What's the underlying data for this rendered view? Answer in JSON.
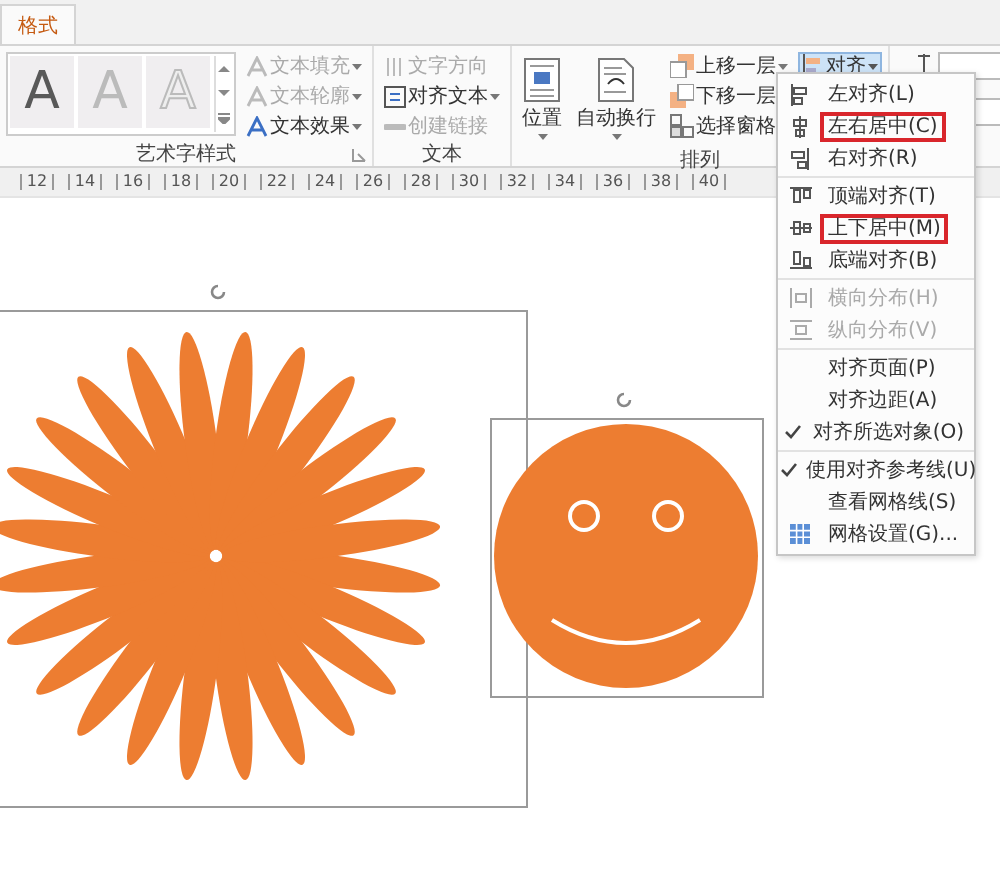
{
  "tabs": [
    {
      "label": "格式",
      "selected": true
    }
  ],
  "wordart": {
    "label": "艺术字样式",
    "styles": [
      {
        "text": "A",
        "kind": "fill"
      },
      {
        "text": "A",
        "kind": "light"
      },
      {
        "text": "A",
        "kind": "outline"
      }
    ],
    "commands": [
      {
        "label": "文本填充",
        "disabled": true
      },
      {
        "label": "文本轮廓",
        "disabled": true
      },
      {
        "label": "文本效果",
        "disabled": false
      }
    ]
  },
  "text_group": {
    "label": "文本",
    "commands": [
      {
        "label": "文字方向",
        "disabled": true
      },
      {
        "label": "对齐文本",
        "disabled": false
      },
      {
        "label": "创建链接",
        "disabled": true
      }
    ]
  },
  "arrange": {
    "label": "排列",
    "large": [
      {
        "label": "位置"
      },
      {
        "label": "自动换行"
      }
    ],
    "small": [
      {
        "label": "上移一层"
      },
      {
        "label": "下移一层"
      },
      {
        "label": "选择窗格"
      }
    ],
    "align_button": {
      "label": "对齐",
      "pressed": true
    }
  },
  "ruler": [
    "12",
    "14",
    "16",
    "18",
    "20",
    "22",
    "24",
    "26",
    "28",
    "30",
    "32",
    "34",
    "36",
    "38",
    "40"
  ],
  "align_menu": {
    "sections": [
      [
        {
          "label": "左对齐(L)",
          "disabled": false,
          "checked": false,
          "highlighted": false
        },
        {
          "label": "左右居中(C)",
          "disabled": false,
          "checked": false,
          "highlighted": true
        },
        {
          "label": "右对齐(R)",
          "disabled": false,
          "checked": false,
          "highlighted": false
        }
      ],
      [
        {
          "label": "顶端对齐(T)",
          "disabled": false,
          "checked": false,
          "highlighted": false
        },
        {
          "label": "上下居中(M)",
          "disabled": false,
          "checked": false,
          "highlighted": true
        },
        {
          "label": "底端对齐(B)",
          "disabled": false,
          "checked": false,
          "highlighted": false
        }
      ],
      [
        {
          "label": "横向分布(H)",
          "disabled": true,
          "checked": false,
          "highlighted": false
        },
        {
          "label": "纵向分布(V)",
          "disabled": true,
          "checked": false,
          "highlighted": false
        }
      ],
      [
        {
          "label": "对齐页面(P)",
          "disabled": false,
          "checked": false,
          "highlighted": false
        },
        {
          "label": "对齐边距(A)",
          "disabled": false,
          "checked": false,
          "highlighted": false
        },
        {
          "label": "对齐所选对象(O)",
          "disabled": false,
          "checked": true,
          "highlighted": false
        }
      ],
      [
        {
          "label": "使用对齐参考线(U)",
          "disabled": false,
          "checked": true,
          "highlighted": false
        },
        {
          "label": "查看网格线(S)",
          "disabled": false,
          "checked": false,
          "highlighted": false
        },
        {
          "label": "网格设置(G)...",
          "disabled": false,
          "checked": false,
          "highlighted": false
        }
      ]
    ]
  }
}
